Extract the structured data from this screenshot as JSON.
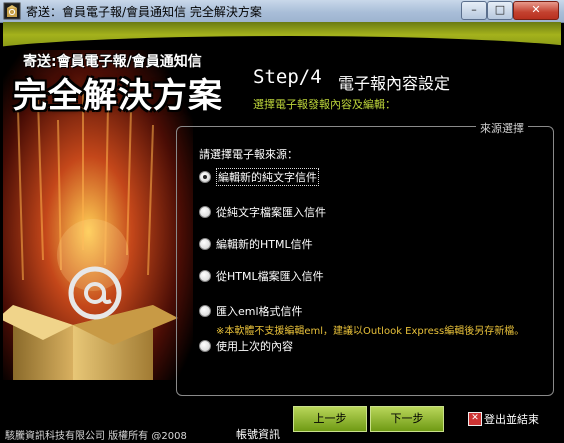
{
  "window": {
    "title": "寄送：會員電子報/會員通知信 完全解決方案",
    "controls": {
      "minimize": "–",
      "maximize": "□",
      "close": "✕"
    }
  },
  "brand": {
    "line1": "寄送:會員電子報/會員通知信",
    "line2": "完全解決方案"
  },
  "header": {
    "step": "Step/4",
    "title": "電子報內容設定",
    "description": "選擇電子報發報內容及編輯："
  },
  "source_group": {
    "label": "來源選擇",
    "prompt": "請選擇電子報來源：",
    "options": [
      {
        "label": "編輯新的純文字信件",
        "selected": true
      },
      {
        "label": "從純文字檔案匯入信件",
        "selected": false
      },
      {
        "label": "編輯新的HTML信件",
        "selected": false
      },
      {
        "label": "從HTML檔案匯入信件",
        "selected": false
      },
      {
        "label": "匯入eml格式信件",
        "selected": false
      },
      {
        "label": "使用上次的內容",
        "selected": false
      }
    ],
    "note": "※本軟體不支援編輯eml，建議以Outlook Express編輯後另存新檔。"
  },
  "footer": {
    "copyright": "駭騰資訊科技有限公司 版權所有 @2008",
    "account_link": "帳號資訊",
    "prev_button": "上一步",
    "next_button": "下一步",
    "exit_button": "登出並結束"
  },
  "colors": {
    "accent_green": "#9fb81c",
    "subtitle_green": "#bcd43a",
    "note_yellow": "#e8c13a"
  }
}
